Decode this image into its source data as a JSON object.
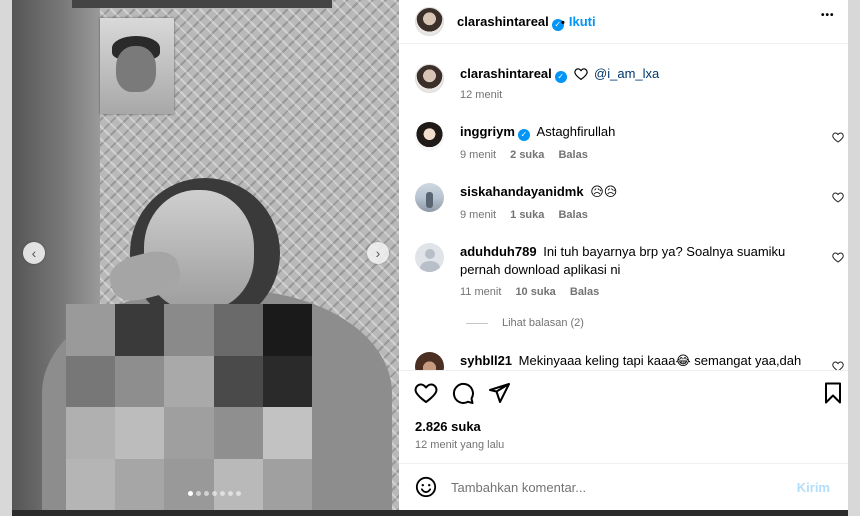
{
  "post": {
    "author": "clarashintareal",
    "follow_label": "Ikuti",
    "separator": "•",
    "more_glyph": "•••",
    "caption": {
      "author": "clarashintareal",
      "mention": "@i_am_lxa",
      "time": "12 menit"
    },
    "likes": "2.826 suka",
    "time_ago": "12 menit yang lalu",
    "media": {
      "total_slides": 7,
      "active_slide": 1,
      "prev_glyph": "‹",
      "next_glyph": "›"
    }
  },
  "comments": [
    {
      "user": "inggriym",
      "verified": true,
      "text": "Astaghfirullah",
      "time": "9 menit",
      "likes": "2 suka",
      "reply": "Balas",
      "avatar": "photo-woman"
    },
    {
      "user": "siskahandayanidmk",
      "verified": false,
      "text": "😥😥",
      "time": "9 menit",
      "likes": "1 suka",
      "reply": "Balas",
      "avatar": "photo-street"
    },
    {
      "user": "aduhduh789",
      "verified": false,
      "text": "Ini tuh bayarnya brp ya? Soalnya suamiku pernah download aplikasi ni",
      "time": "11 menit",
      "likes": "10 suka",
      "reply": "Balas",
      "avatar": "default-user",
      "view_replies": "Lihat balasan (2)"
    },
    {
      "user": "syhbll21",
      "verified": false,
      "text": "Mekinyaaa keling tapi kaaa😂 semangat yaa,dah",
      "avatar": "photo-person"
    }
  ],
  "composer": {
    "placeholder": "Tambahkan komentar...",
    "post_label": "Kirim"
  },
  "icons": {
    "like": "heart-icon",
    "comment": "comment-icon",
    "share": "send-icon",
    "save": "bookmark-icon",
    "emoji": "smiley-icon",
    "verified": "verified-badge-icon"
  },
  "colors": {
    "link_blue": "#0095f6",
    "meta_gray": "#737373",
    "mention_blue": "#00376b",
    "post_disabled": "#b2dffc"
  }
}
